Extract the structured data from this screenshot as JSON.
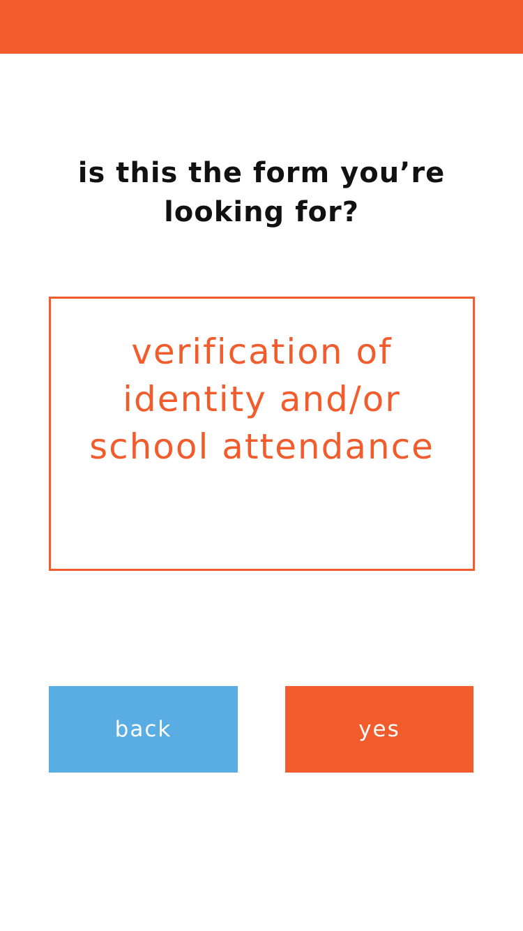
{
  "header": {
    "bar_color": "#F25C2C"
  },
  "question": {
    "line1": "is this the form you’re",
    "line2": "looking for?"
  },
  "form": {
    "line1": "verification of",
    "line2": "identity and/or",
    "line3": "school attendance",
    "accent_color": "#F25C2C"
  },
  "buttons": {
    "back_label": "back",
    "back_color": "#5AADE3",
    "yes_label": "yes",
    "yes_color": "#F25C2C"
  }
}
